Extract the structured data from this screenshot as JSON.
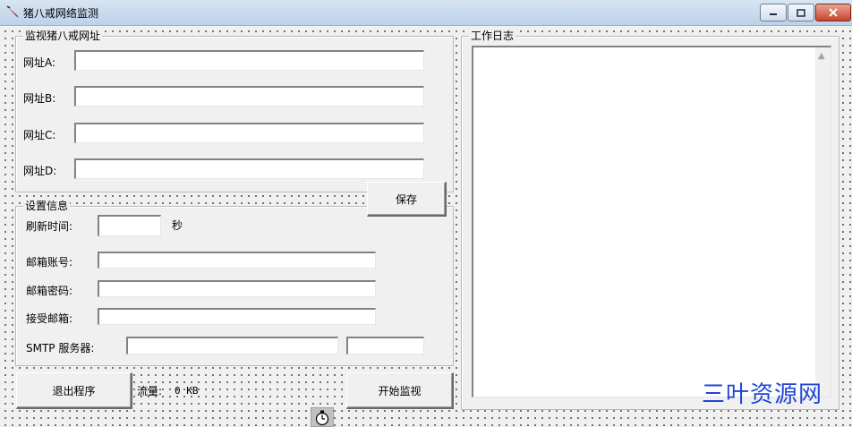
{
  "window": {
    "title": "猪八戒网络监测",
    "icon": "app-brush-icon",
    "controls": [
      "minimize-icon",
      "maximize-icon",
      "close-icon"
    ]
  },
  "monitor_group": {
    "title": "监视猪八戒网址",
    "fields": [
      {
        "label": "网址A:",
        "value": ""
      },
      {
        "label": "网址B:",
        "value": ""
      },
      {
        "label": "网址C:",
        "value": ""
      },
      {
        "label": "网址D:",
        "value": ""
      }
    ]
  },
  "save_button": "保存",
  "settings_group": {
    "title": "设置信息",
    "refresh_label": "刷新时间:",
    "refresh_value": "",
    "refresh_unit": "秒",
    "email_account_label": "邮箱账号:",
    "email_password_label": "邮箱密码:",
    "receive_email_label": "接受邮箱:",
    "smtp_label": "SMTP 服务器:",
    "smtp_server_value": "",
    "smtp_port_value": ""
  },
  "exit_button": "退出程序",
  "traffic": {
    "label": "流量:",
    "value": "0 KB"
  },
  "start_button": "开始监视",
  "log_group": {
    "title": "工作日志",
    "content": ""
  },
  "watermark": "三叶资源网",
  "timer_icon": "stopwatch-icon",
  "colors": {
    "watermark": "#1f44d6",
    "title_bar": "#c9dbef"
  }
}
